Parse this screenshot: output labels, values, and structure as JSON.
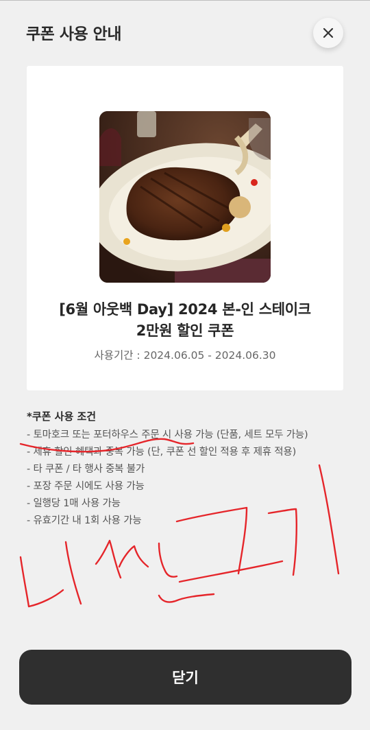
{
  "header": {
    "title": "쿠폰 사용 안내",
    "close_icon": "close-icon"
  },
  "coupon": {
    "image_alt": "steak",
    "title_line1": "[6월 아웃백 Day] 2024 본-인 스테이크",
    "title_line2": "2만원 할인 쿠폰",
    "period": "사용기간 : 2024.06.05 - 2024.06.30"
  },
  "conditions": {
    "title": "*쿠폰 사용 조건",
    "items": [
      "- 토마호크 또는 포터하우스  주문 시 사용 가능 (단품, 세트 모두 가능)",
      "- 제휴 할인 혜택과 중복 가능 (단, 쿠폰 선 할인 적용 후 제휴 적용)",
      "- 타 쿠폰 / 타 행사 중복 불가",
      "- 포장 주문 시에도 사용 가능",
      "- 일행당 1매 사용 가능",
      "- 유효기간 내 1회 사용 가능"
    ]
  },
  "annotation": {
    "handwriting": "비싼고기",
    "color": "#e5252a"
  },
  "footer": {
    "close_label": "닫기"
  }
}
